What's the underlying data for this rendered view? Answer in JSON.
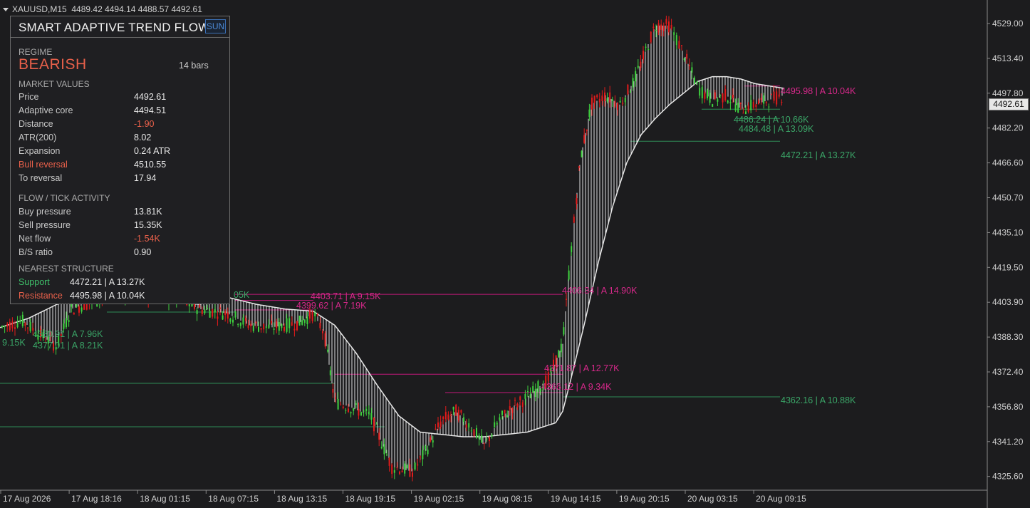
{
  "header": {
    "symbol": "XAUUSD,M15",
    "ohlc": "4489.42 4494.14 4488.57 4492.61"
  },
  "current_price_tag": "4492.61",
  "panel": {
    "title": "SMART ADAPTIVE TREND FLOW",
    "theme_button": "SUN",
    "regime_label": "REGIME",
    "regime_value": "BEARISH",
    "bars": "14 bars",
    "market_values_label": "MARKET VALUES",
    "market_values": [
      {
        "label": "Price",
        "value": "4492.61",
        "neg": false
      },
      {
        "label": "Adaptive core",
        "value": "4494.51",
        "neg": false
      },
      {
        "label": "Distance",
        "value": "-1.90",
        "neg": true
      },
      {
        "label": "ATR(200)",
        "value": "8.02",
        "neg": false
      },
      {
        "label": "Expansion",
        "value": "0.24 ATR",
        "neg": false
      },
      {
        "label": "Bull reversal",
        "value": "4510.55",
        "neg": false,
        "label_red": true
      },
      {
        "label": "To reversal",
        "value": "17.94",
        "neg": false
      }
    ],
    "flow_label": "FLOW / TICK ACTIVITY",
    "flow_values": [
      {
        "label": "Buy pressure",
        "value": "13.81K",
        "neg": false
      },
      {
        "label": "Sell pressure",
        "value": "15.35K",
        "neg": false
      },
      {
        "label": "Net flow",
        "value": "-1.54K",
        "neg": true
      },
      {
        "label": "B/S ratio",
        "value": "0.90",
        "neg": false
      }
    ],
    "structure_label": "NEAREST STRUCTURE",
    "support_label": "Support",
    "support_value": "4472.21 | A 13.27K",
    "resistance_label": "Resistance",
    "resistance_value": "4495.98 | A 10.04K"
  },
  "colors": {
    "bg": "#1c1c1e",
    "bull": "#3fd23f",
    "bear": "#e21b1b",
    "band_fill": "#f2f2f2",
    "support_line": "#2e8b57",
    "resistance_line": "#c2187a"
  },
  "chart_data": {
    "type": "candlestick",
    "y_ticks": [
      "4529.00",
      "4513.40",
      "4497.80",
      "4482.20",
      "4466.60",
      "4450.70",
      "4435.10",
      "4419.50",
      "4403.90",
      "4388.30",
      "4372.40",
      "4356.80",
      "4341.20",
      "4325.60"
    ],
    "x_ticks": [
      "17 Aug 2026",
      "17 Aug 18:16",
      "18 Aug 01:15",
      "18 Aug 07:15",
      "18 Aug 13:15",
      "18 Aug 19:15",
      "19 Aug 02:15",
      "19 Aug 08:15",
      "19 Aug 14:15",
      "19 Aug 20:15",
      "20 Aug 03:15",
      "20 Aug 09:15"
    ],
    "ylim": [
      4322,
      4533
    ],
    "levels": [
      {
        "text": "4495.98 | A 10.04K",
        "price": 4495.98,
        "kind": "resistance"
      },
      {
        "text": "4472.21 | A 13.27K",
        "price": 4472.21,
        "kind": "support"
      },
      {
        "text": "4362.16 | A 10.88K",
        "price": 4362.16,
        "kind": "support"
      },
      {
        "text": "4406.34 | A 14.90K",
        "price": 4406.3,
        "kind": "resistance"
      },
      {
        "text": "4371.87 | A 12.77K",
        "price": 4371.9,
        "kind": "resistance"
      },
      {
        "text": "4403.71 | A 9.15K",
        "price": 4403.7,
        "kind": "resistance"
      },
      {
        "text": "4399.62 | A 7.19K",
        "price": 4399.6,
        "kind": "resistance"
      },
      {
        "text": "4380.91 | A 7.96K",
        "price": 4388.0,
        "kind": "support"
      },
      {
        "text": "4377.01 | A 8.21K",
        "price": 4382.0,
        "kind": "support"
      },
      {
        "text": "4484.48 | A 13.09K",
        "price": 4482.0,
        "kind": "support"
      },
      {
        "text": "4486.24 | A 10.66K",
        "price": 4486.0,
        "kind": "support"
      },
      {
        "text": "4366.12 | A 9.34K",
        "price": 4364.0,
        "kind": "resistance"
      },
      {
        "text": "9.15K",
        "price": 4383.0,
        "kind": "support"
      },
      {
        "text": "05K",
        "price": 4407.0,
        "kind": "support"
      }
    ],
    "core_curve": [
      [
        0,
        4392
      ],
      [
        40,
        4396
      ],
      [
        80,
        4402
      ],
      [
        120,
        4405
      ],
      [
        160,
        4406
      ],
      [
        200,
        4405
      ],
      [
        240,
        4403
      ],
      [
        280,
        4402
      ],
      [
        320,
        4405
      ],
      [
        360,
        4402
      ],
      [
        400,
        4400
      ],
      [
        440,
        4399
      ],
      [
        470,
        4393
      ],
      [
        500,
        4381
      ],
      [
        530,
        4367
      ],
      [
        560,
        4354
      ],
      [
        590,
        4347
      ],
      [
        620,
        4346
      ],
      [
        650,
        4345
      ],
      [
        680,
        4345
      ],
      [
        710,
        4346
      ],
      [
        740,
        4347
      ],
      [
        760,
        4349
      ],
      [
        780,
        4351
      ],
      [
        790,
        4356
      ],
      [
        800,
        4368
      ],
      [
        820,
        4393
      ],
      [
        840,
        4420
      ],
      [
        860,
        4444
      ],
      [
        880,
        4463
      ],
      [
        900,
        4475
      ],
      [
        920,
        4482
      ],
      [
        940,
        4488
      ],
      [
        960,
        4493
      ],
      [
        980,
        4498
      ],
      [
        1000,
        4500
      ],
      [
        1020,
        4500
      ],
      [
        1040,
        4499
      ],
      [
        1060,
        4497
      ],
      [
        1080,
        4496
      ],
      [
        1100,
        4495
      ]
    ]
  }
}
